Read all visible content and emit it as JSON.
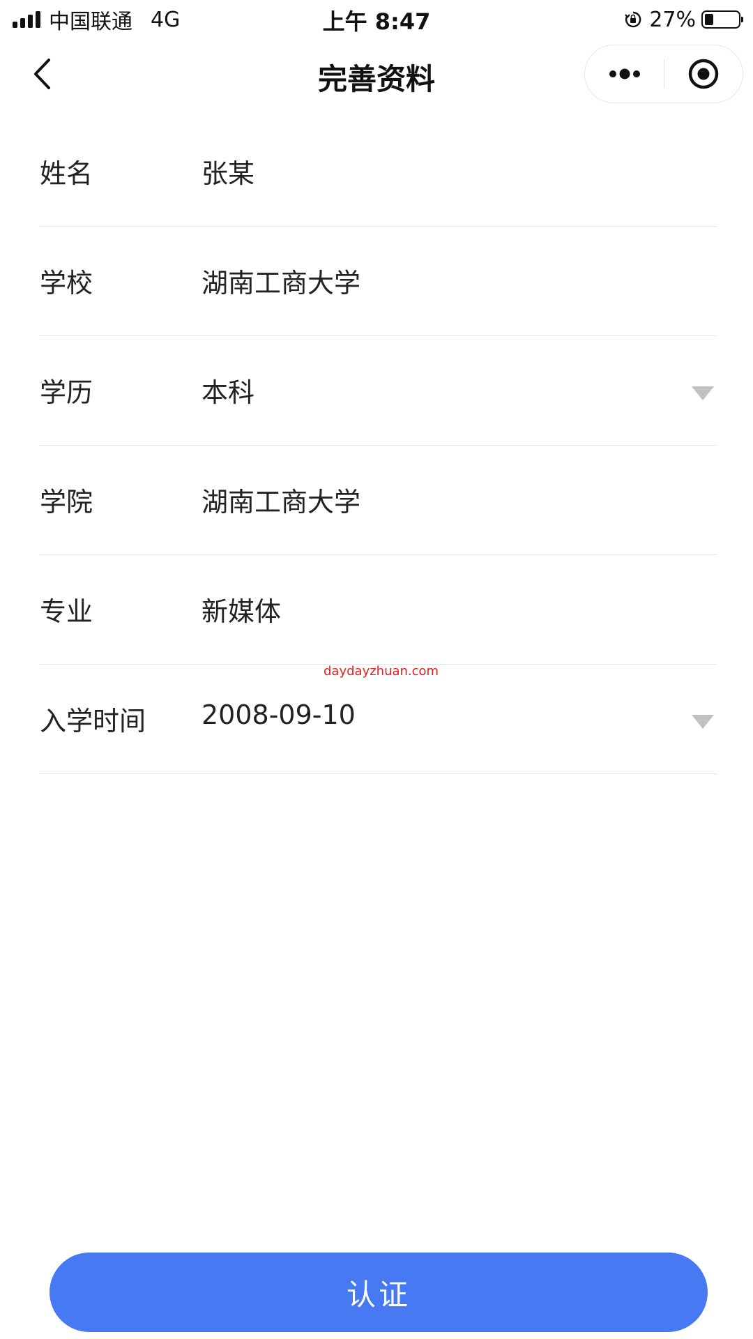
{
  "status_bar": {
    "carrier": "中国联通",
    "network": "4G",
    "time": "上午 8:47",
    "battery_percent": "27%",
    "battery_level": 0.27,
    "icons": [
      "signal-icon",
      "orientation-lock-icon",
      "battery-icon"
    ]
  },
  "nav": {
    "title": "完善资料",
    "back_icon": "chevron-left-icon",
    "more_icon": "more-dots-icon",
    "close_icon": "target-circle-icon"
  },
  "form": {
    "rows": [
      {
        "label": "姓名",
        "value": "张某"
      },
      {
        "label": "学校",
        "value": "湖南工商大学"
      },
      {
        "label": "学历",
        "value": "本科"
      },
      {
        "label": "学院",
        "value": "湖南工商大学"
      },
      {
        "label": "专业",
        "value": "新媒体"
      },
      {
        "label": "入学时间",
        "value": "2008-09-10"
      }
    ]
  },
  "watermark": "daydayzhuan.com",
  "submit_label": "认证",
  "colors": {
    "primary_button": "#4679f2",
    "divider": "#e5e5e5",
    "dropdown_arrow": "#c0c0c6",
    "watermark": "#e02020"
  }
}
